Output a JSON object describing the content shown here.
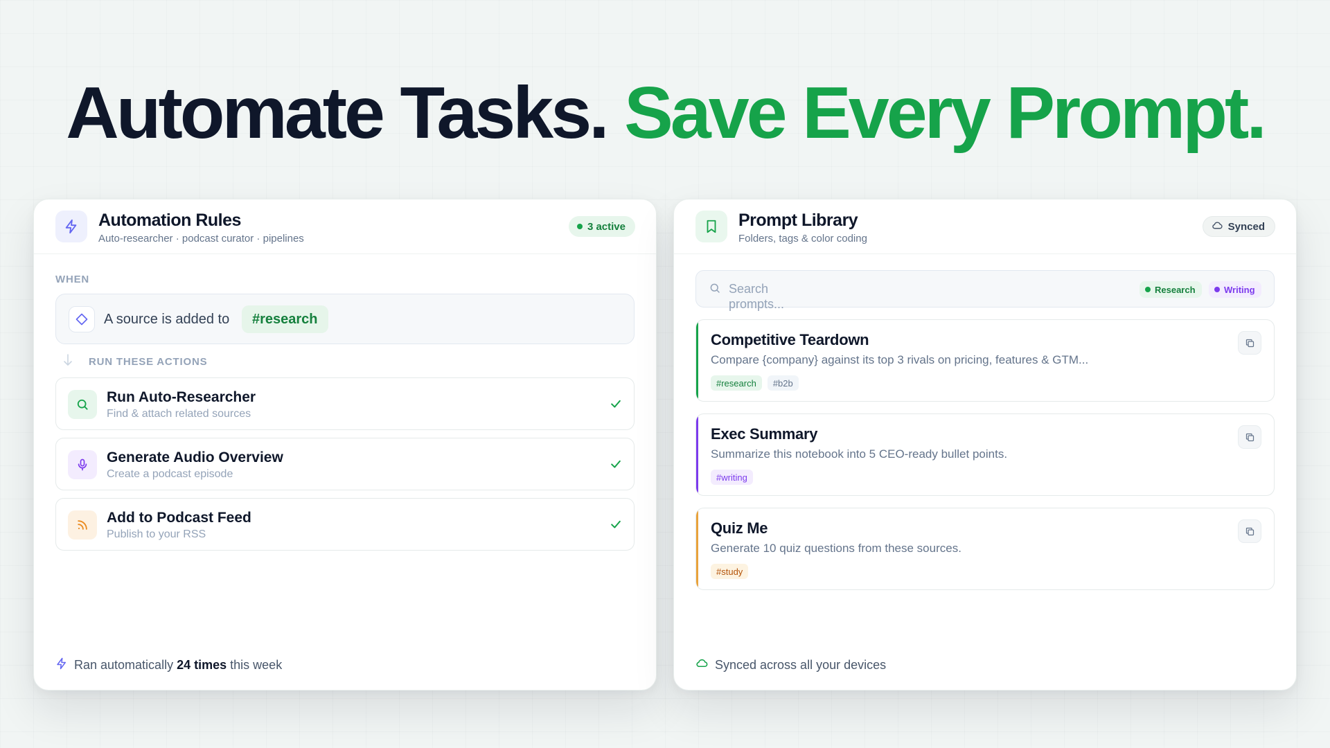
{
  "headline": {
    "part1": "Automate Tasks.",
    "part2": "Save Every Prompt."
  },
  "colors": {
    "green": "#16a34a",
    "indigo": "#6366f1",
    "purple": "#7c3aed",
    "amber": "#f59e0b",
    "dark": "#0f172a"
  },
  "automation": {
    "title": "Automation Rules",
    "subtitle": "Auto-researcher · podcast curator · pipelines",
    "badge": "3 active",
    "when_label": "WHEN",
    "trigger_text": "A source is added to",
    "trigger_tag": "#research",
    "run_label": "RUN THESE ACTIONS",
    "actions": [
      {
        "title": "Run Auto-Researcher",
        "subtitle": "Find & attach related sources",
        "icon": "search-icon",
        "done": true
      },
      {
        "title": "Generate Audio Overview",
        "subtitle": "Create a podcast episode",
        "icon": "mic-icon",
        "done": true
      },
      {
        "title": "Add to Podcast Feed",
        "subtitle": "Publish to your RSS",
        "icon": "rss-icon",
        "done": true
      }
    ],
    "footer_prefix": "Ran automatically",
    "footer_count": "24 times",
    "footer_suffix": "this week"
  },
  "library": {
    "title": "Prompt Library",
    "subtitle": "Folders, tags & color coding",
    "badge": "Synced",
    "search_placeholder": "Search prompts...",
    "filters": [
      "Research",
      "Writing"
    ],
    "prompts": [
      {
        "title": "Competitive Teardown",
        "description": "Compare {company} against its top 3 rivals on pricing, features & GTM...",
        "tags": [
          "#research",
          "#b2b"
        ],
        "accent": "#16a34a"
      },
      {
        "title": "Exec Summary",
        "description": "Summarize this notebook into 5 CEO-ready bullet points.",
        "tags": [
          "#writing"
        ],
        "accent": "#7c3aed"
      },
      {
        "title": "Quiz Me",
        "description": "Generate 10 quiz questions from these sources.",
        "tags": [
          "#study"
        ],
        "accent": "#e9a23b"
      }
    ],
    "footer": "Synced across all your devices"
  }
}
